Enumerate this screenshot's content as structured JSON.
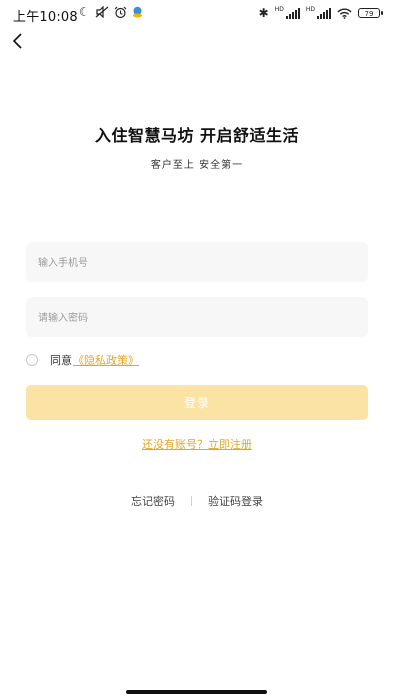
{
  "status_bar": {
    "time": "上午10:08",
    "battery": "79",
    "signal_label_1": "HD",
    "signal_label_2": "HD"
  },
  "header": {
    "title": "入住智慧马坊 开启舒适生活",
    "subtitle": "客户至上 安全第一"
  },
  "form": {
    "phone_placeholder": "输入手机号",
    "phone_value": "",
    "password_placeholder": "请输入密码",
    "password_value": "",
    "agree_label": "同意",
    "policy_link": "《隐私政策》",
    "agreed": false,
    "login_label": "登录"
  },
  "links": {
    "register": "还没有账号？立即注册",
    "forgot_password": "忘记密码",
    "code_login": "验证码登录"
  },
  "colors": {
    "accent": "#e2a72a",
    "login_button_bg": "#fbe3a5",
    "field_bg": "#f7f7f8"
  }
}
